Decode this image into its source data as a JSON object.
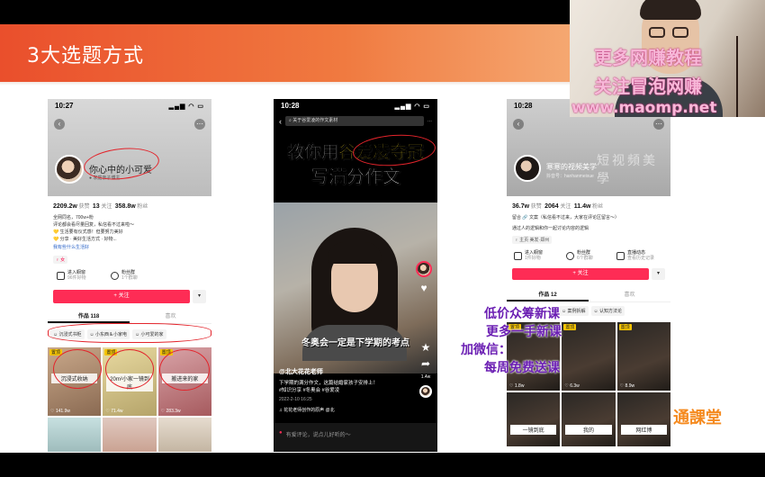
{
  "slide": {
    "title": "3大选题方式"
  },
  "phone1": {
    "time": "10:27",
    "status_icons": "▂▄▆ ◠ ▭",
    "name": "你心中的小可爱",
    "sub": "● 家庭亲子博主",
    "stats": [
      {
        "num": "2209.2w",
        "label": "获赞"
      },
      {
        "num": "13",
        "label": "关注"
      },
      {
        "num": "358.8w",
        "label": "粉丝"
      }
    ],
    "bio": [
      "全网同名，700w+粉",
      "评论都会看尽量回复，私信看不过来啦～",
      "💛 生活要有仪式感！但要努力美好",
      "💛 分享 · 美好生活方式 · 好物...",
      "我有些什么生活好～"
    ],
    "bio_link": "我有些什么生活好",
    "tag": "♀ 女",
    "shop1_title": "进入橱窗",
    "shop1_sub": "96件好物",
    "shop2_title": "粉丝群",
    "shop2_sub": "1个群聊",
    "follow": "+ 关注",
    "drop": "▾",
    "tab_works": "作品 118",
    "tab_likes": "喜欢",
    "chips": [
      "☺ 沉浸式书柜",
      "☺ 小东西＆小家电",
      "☺ 小可爱的家"
    ],
    "thumbs": [
      {
        "cap": "沉浸式收纳",
        "likes": "♡ 141.9w",
        "pin": "置顶"
      },
      {
        "cap": "20m²小家一镜到底",
        "likes": "♡ 71.4w",
        "pin": "置顶"
      },
      {
        "cap": "搬进来的家",
        "likes": "♡ 283.3w",
        "pin": "置顶"
      }
    ]
  },
  "phone2": {
    "time": "10:28",
    "status_icons": "▂▄▆ ◠ ▭",
    "back": "‹",
    "search": "关于谷爱凌的作文素材",
    "more": "⋯",
    "headline1": "教你用谷爱凌夺冠",
    "headline1_highlight": "谷爱凌夺冠",
    "headline2": "写满分作文",
    "subtitle": "冬奥会一定是下学期的考点",
    "user": "@北大花花老师",
    "desc1": "下学期的满分作文，这篇结婚家孩子安排上！",
    "desc2": "#知识分享 #冬奥会 #谷爱凌",
    "date": "2022-2-10 16:25",
    "music": "♫ 花花老师创作的原声    @北",
    "like_count": "",
    "share_count": "1.4w",
    "comment_placeholder": "有爱评论，说点儿好听的～",
    "icons": {
      "like": "heart-icon",
      "star": "star-icon",
      "share": "share-icon"
    }
  },
  "phone3": {
    "time": "10:28",
    "status_icons": "▂▄▆ ◠ ▭",
    "name": "寒寒的视频美学",
    "watermark": "短视頻美學",
    "sub": "抖音号：hanhanmeixue",
    "stats": [
      {
        "num": "36.7w",
        "label": "获赞"
      },
      {
        "num": "2064",
        "label": "关注"
      },
      {
        "num": "11.4w",
        "label": "粉丝"
      }
    ],
    "bio": [
      "留合 🔗 文案（私信看不过来，大家在评论区留言～）",
      "通过人的逻辑和你一起讨论内容的逻辑"
    ],
    "tags": "♀ 主页  美发·郑州",
    "shop1_title": "进入橱窗",
    "shop1_sub": "1件好物",
    "shop2_title": "粉丝群",
    "shop2_sub": "6个群聊",
    "shop3_title": "直播动态",
    "shop3_sub": "查看历史记录",
    "follow": "+ 关注",
    "drop": "▾",
    "tab_works": "作品 12",
    "tab_likes": "喜欢",
    "chips": [
      "☺ 案例拆解",
      "☺ 认知方法论"
    ],
    "pins": [
      "置顶",
      "置顶",
      "置顶"
    ],
    "likes": [
      "♡ 1.8w",
      "♡ 6.3w",
      "♡ 8.9w"
    ],
    "bottom_caps": [
      "一镜到底",
      "我的",
      "网红博"
    ]
  },
  "overlays": {
    "wm1": "更多网赚教程",
    "wm2": "关注冒泡网赚",
    "wm3": "www.maomp.net",
    "promo": [
      "低价众筹新课",
      "更多一手新课",
      "加微信：",
      "每周免费送课"
    ],
    "brand": "通課堂"
  }
}
